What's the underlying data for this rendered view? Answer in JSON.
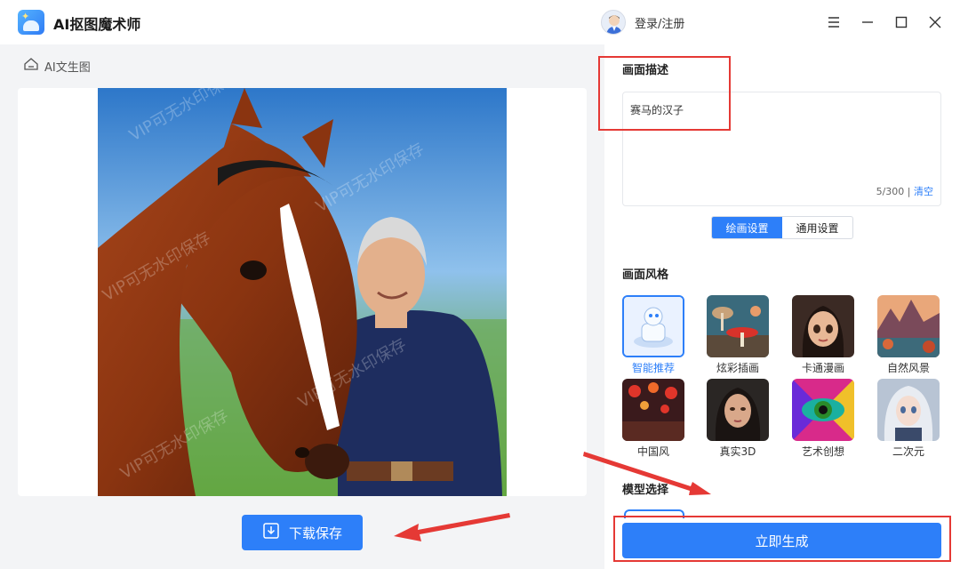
{
  "app": {
    "title": "AI抠图魔术师",
    "login_label": "登录/注册"
  },
  "breadcrumb": {
    "label": "AI文生图"
  },
  "preview": {
    "watermark": "VIP可无水印保存",
    "alt": ""
  },
  "download_button": {
    "label": "下载保存"
  },
  "description": {
    "title": "画面描述",
    "value": "赛马的汉子",
    "count": "5/300",
    "separator": "|",
    "clear_label": "清空"
  },
  "settings_tabs": [
    {
      "label": "绘画设置",
      "active": true
    },
    {
      "label": "通用设置",
      "active": false
    }
  ],
  "styles": {
    "title": "画面风格",
    "items": [
      {
        "label": "智能推荐",
        "selected": true,
        "icon": "robot-icon"
      },
      {
        "label": "炫彩插画",
        "selected": false,
        "icon": "mushroom-illustration-thumb"
      },
      {
        "label": "卡通漫画",
        "selected": false,
        "icon": "cartoon-girl-thumb"
      },
      {
        "label": "自然风景",
        "selected": false,
        "icon": "landscape-thumb"
      },
      {
        "label": "中国风",
        "selected": false,
        "icon": "chinese-lanterns-thumb"
      },
      {
        "label": "真实3D",
        "selected": false,
        "icon": "realistic-portrait-thumb"
      },
      {
        "label": "艺术创想",
        "selected": false,
        "icon": "art-eye-thumb"
      },
      {
        "label": "二次元",
        "selected": false,
        "icon": "anime-girl-thumb"
      }
    ]
  },
  "model": {
    "title": "模型选择"
  },
  "generate_button": {
    "label": "立即生成"
  },
  "colors": {
    "accent": "#2d7ff9",
    "annotation": "#e53935",
    "panel_bg": "#f3f4f6"
  }
}
